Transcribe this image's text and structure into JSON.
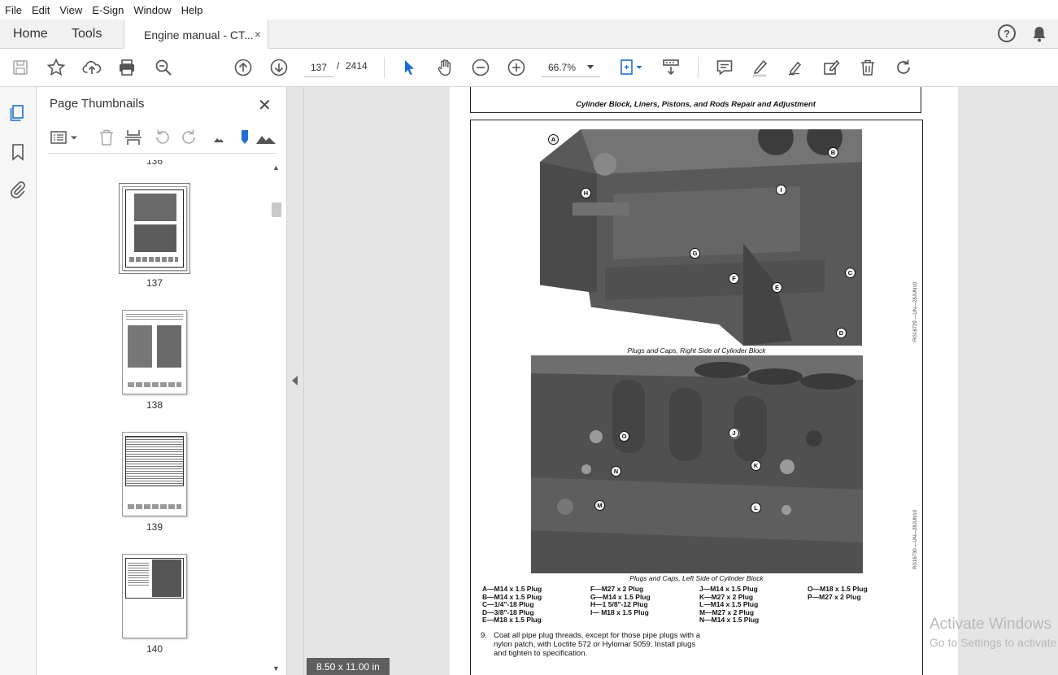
{
  "menu": [
    "File",
    "Edit",
    "View",
    "E-Sign",
    "Window",
    "Help"
  ],
  "tabs": {
    "home": "Home",
    "tools": "Tools",
    "document": "Engine manual - CT...",
    "close": "×"
  },
  "toolbar": {
    "page_current": "137",
    "page_separator": "/",
    "page_total": "2414",
    "zoom": "66.7%"
  },
  "panel": {
    "title": "Page Thumbnails",
    "close": "✕",
    "partial_label": "136",
    "thumbnails": [
      {
        "label": "137",
        "selected": true
      },
      {
        "label": "138",
        "selected": false
      },
      {
        "label": "139",
        "selected": false
      },
      {
        "label": "140",
        "selected": false
      }
    ]
  },
  "document": {
    "header": "Cylinder Block, Liners, Pistons, and Rods Repair and Adjustment",
    "figure1_caption": "Plugs and Caps, Right Side of Cylinder Block",
    "figure2_caption": "Plugs and Caps, Left Side of Cylinder Block",
    "figure1_code": "RG16729 —UN—28JUN10",
    "figure2_code": "RG16730 —UN—28JUN10",
    "figure1_callouts": [
      "A",
      "B",
      "H",
      "I",
      "G",
      "F",
      "C",
      "E",
      "D"
    ],
    "figure2_callouts": [
      "O",
      "J",
      "N",
      "K",
      "M",
      "L"
    ],
    "legend": {
      "col1": [
        "A—M14 x 1.5 Plug",
        "B—M14 x 1.5 Plug",
        "C—1/4\"-18 Plug",
        "D—3/8\"-18 Plug",
        "E—M18 x 1.5 Plug"
      ],
      "col2": [
        "F—M27 x 2 Plug",
        "G—M14 x 1.5 Plug",
        "H—1 5/8\"-12 Plug",
        "I— M18 x 1.5 Plug"
      ],
      "col3": [
        "J—M14 x 1.5 Plug",
        "K—M27 x 2 Plug",
        "L—M14 x 1.5 Plug",
        "M—M27 x 2 Plug",
        "N—M14 x 1.5 Plug"
      ],
      "col4": [
        "O—M18 x 1.5 Plug",
        "P—M27 x 2 Plug"
      ]
    },
    "step_number": "9.",
    "step_text": "Coat all pipe plug threads, except for those pipe plugs with a nylon patch, with Loctite 572 or Hylomar 5059. Install plugs and tighten to specification."
  },
  "page_size": "8.50 x 11.00 in",
  "watermark": {
    "line1": "Activate Windows",
    "line2": "Go to Settings to activate Windows."
  }
}
